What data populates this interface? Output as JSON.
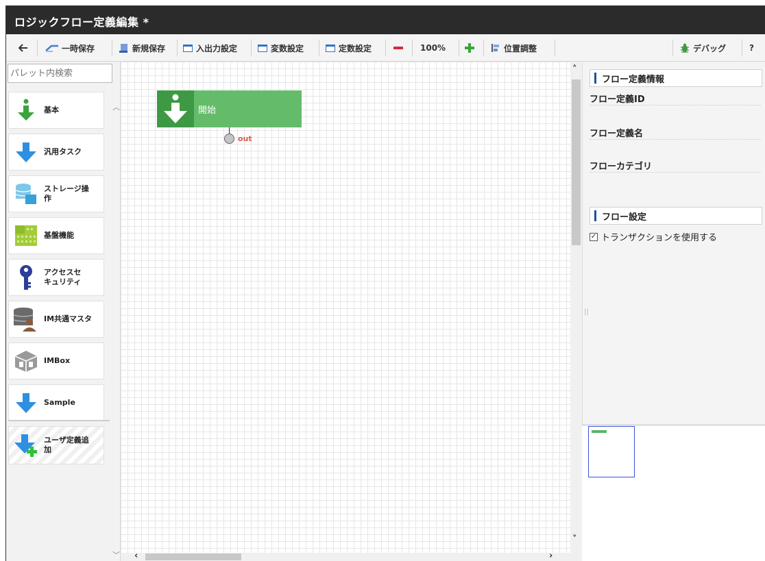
{
  "window": {
    "title": "ロジックフロー定義編集 *"
  },
  "toolbar": {
    "back_icon": "arrow-left-icon",
    "temp_save_label": "一時保存",
    "new_save_label": "新規保存",
    "io_settings_label": "入出力設定",
    "var_settings_label": "変数設定",
    "const_settings_label": "定数設定",
    "zoom_level": "100%",
    "position_adjust_label": "位置調整",
    "debug_label": "デバッグ",
    "help_label": "?"
  },
  "palette": {
    "search_placeholder": "パレット内検索",
    "items": [
      {
        "label": "基本",
        "icon": "green-down-arrow-icon"
      },
      {
        "label": "汎用タスク",
        "icon": "blue-down-arrow-icon"
      },
      {
        "label": "ストレージ操\n作",
        "icon": "storage-icon"
      },
      {
        "label": "基盤機能",
        "icon": "grid-block-icon"
      },
      {
        "label": "アクセスセ\nキュリティ",
        "icon": "key-icon"
      },
      {
        "label": "IM共通マスタ",
        "icon": "database-user-icon"
      },
      {
        "label": "IMBox",
        "icon": "box-icon"
      },
      {
        "label": "Sample",
        "icon": "blue-down-arrow-icon"
      },
      {
        "label": "ユーザ定義追\n加",
        "icon": "add-user-defined-icon"
      }
    ]
  },
  "canvas": {
    "start_node_label": "開始",
    "port_label": "out"
  },
  "properties": {
    "flow_info_title": "フロー定義情報",
    "flow_id_label": "フロー定義ID",
    "flow_name_label": "フロー定義名",
    "flow_category_label": "フローカテゴリ",
    "flow_settings_title": "フロー設定",
    "use_transaction_label": "トランザクションを使用する",
    "use_transaction_checked": true
  },
  "colors": {
    "titlebar": "#2b2b2b",
    "node": "#64bc6a",
    "node_icon": "#3e9944",
    "accent_blue": "#1f4fa0"
  }
}
